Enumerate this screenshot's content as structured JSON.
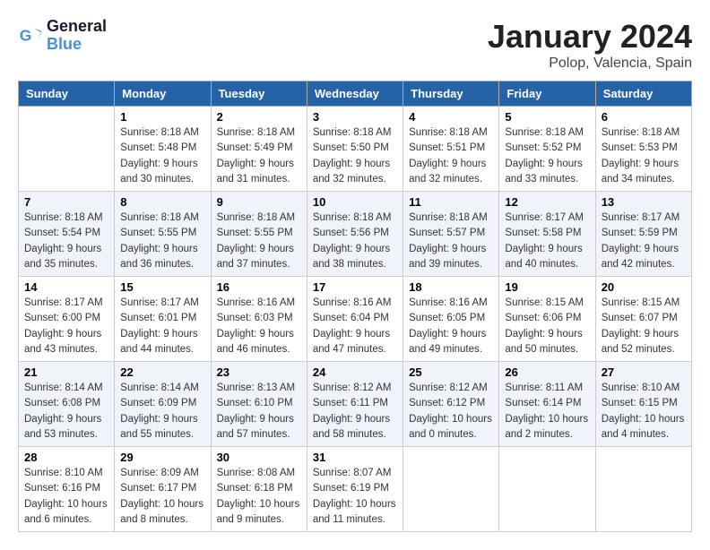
{
  "header": {
    "logo_line1": "General",
    "logo_line2": "Blue",
    "month_title": "January 2024",
    "location": "Polop, Valencia, Spain"
  },
  "days_of_week": [
    "Sunday",
    "Monday",
    "Tuesday",
    "Wednesday",
    "Thursday",
    "Friday",
    "Saturday"
  ],
  "weeks": [
    [
      {
        "num": "",
        "sunrise": "",
        "sunset": "",
        "daylight": "",
        "empty": true
      },
      {
        "num": "1",
        "sunrise": "Sunrise: 8:18 AM",
        "sunset": "Sunset: 5:48 PM",
        "daylight": "Daylight: 9 hours and 30 minutes."
      },
      {
        "num": "2",
        "sunrise": "Sunrise: 8:18 AM",
        "sunset": "Sunset: 5:49 PM",
        "daylight": "Daylight: 9 hours and 31 minutes."
      },
      {
        "num": "3",
        "sunrise": "Sunrise: 8:18 AM",
        "sunset": "Sunset: 5:50 PM",
        "daylight": "Daylight: 9 hours and 32 minutes."
      },
      {
        "num": "4",
        "sunrise": "Sunrise: 8:18 AM",
        "sunset": "Sunset: 5:51 PM",
        "daylight": "Daylight: 9 hours and 32 minutes."
      },
      {
        "num": "5",
        "sunrise": "Sunrise: 8:18 AM",
        "sunset": "Sunset: 5:52 PM",
        "daylight": "Daylight: 9 hours and 33 minutes."
      },
      {
        "num": "6",
        "sunrise": "Sunrise: 8:18 AM",
        "sunset": "Sunset: 5:53 PM",
        "daylight": "Daylight: 9 hours and 34 minutes."
      }
    ],
    [
      {
        "num": "7",
        "sunrise": "Sunrise: 8:18 AM",
        "sunset": "Sunset: 5:54 PM",
        "daylight": "Daylight: 9 hours and 35 minutes."
      },
      {
        "num": "8",
        "sunrise": "Sunrise: 8:18 AM",
        "sunset": "Sunset: 5:55 PM",
        "daylight": "Daylight: 9 hours and 36 minutes."
      },
      {
        "num": "9",
        "sunrise": "Sunrise: 8:18 AM",
        "sunset": "Sunset: 5:55 PM",
        "daylight": "Daylight: 9 hours and 37 minutes."
      },
      {
        "num": "10",
        "sunrise": "Sunrise: 8:18 AM",
        "sunset": "Sunset: 5:56 PM",
        "daylight": "Daylight: 9 hours and 38 minutes."
      },
      {
        "num": "11",
        "sunrise": "Sunrise: 8:18 AM",
        "sunset": "Sunset: 5:57 PM",
        "daylight": "Daylight: 9 hours and 39 minutes."
      },
      {
        "num": "12",
        "sunrise": "Sunrise: 8:17 AM",
        "sunset": "Sunset: 5:58 PM",
        "daylight": "Daylight: 9 hours and 40 minutes."
      },
      {
        "num": "13",
        "sunrise": "Sunrise: 8:17 AM",
        "sunset": "Sunset: 5:59 PM",
        "daylight": "Daylight: 9 hours and 42 minutes."
      }
    ],
    [
      {
        "num": "14",
        "sunrise": "Sunrise: 8:17 AM",
        "sunset": "Sunset: 6:00 PM",
        "daylight": "Daylight: 9 hours and 43 minutes."
      },
      {
        "num": "15",
        "sunrise": "Sunrise: 8:17 AM",
        "sunset": "Sunset: 6:01 PM",
        "daylight": "Daylight: 9 hours and 44 minutes."
      },
      {
        "num": "16",
        "sunrise": "Sunrise: 8:16 AM",
        "sunset": "Sunset: 6:03 PM",
        "daylight": "Daylight: 9 hours and 46 minutes."
      },
      {
        "num": "17",
        "sunrise": "Sunrise: 8:16 AM",
        "sunset": "Sunset: 6:04 PM",
        "daylight": "Daylight: 9 hours and 47 minutes."
      },
      {
        "num": "18",
        "sunrise": "Sunrise: 8:16 AM",
        "sunset": "Sunset: 6:05 PM",
        "daylight": "Daylight: 9 hours and 49 minutes."
      },
      {
        "num": "19",
        "sunrise": "Sunrise: 8:15 AM",
        "sunset": "Sunset: 6:06 PM",
        "daylight": "Daylight: 9 hours and 50 minutes."
      },
      {
        "num": "20",
        "sunrise": "Sunrise: 8:15 AM",
        "sunset": "Sunset: 6:07 PM",
        "daylight": "Daylight: 9 hours and 52 minutes."
      }
    ],
    [
      {
        "num": "21",
        "sunrise": "Sunrise: 8:14 AM",
        "sunset": "Sunset: 6:08 PM",
        "daylight": "Daylight: 9 hours and 53 minutes."
      },
      {
        "num": "22",
        "sunrise": "Sunrise: 8:14 AM",
        "sunset": "Sunset: 6:09 PM",
        "daylight": "Daylight: 9 hours and 55 minutes."
      },
      {
        "num": "23",
        "sunrise": "Sunrise: 8:13 AM",
        "sunset": "Sunset: 6:10 PM",
        "daylight": "Daylight: 9 hours and 57 minutes."
      },
      {
        "num": "24",
        "sunrise": "Sunrise: 8:12 AM",
        "sunset": "Sunset: 6:11 PM",
        "daylight": "Daylight: 9 hours and 58 minutes."
      },
      {
        "num": "25",
        "sunrise": "Sunrise: 8:12 AM",
        "sunset": "Sunset: 6:12 PM",
        "daylight": "Daylight: 10 hours and 0 minutes."
      },
      {
        "num": "26",
        "sunrise": "Sunrise: 8:11 AM",
        "sunset": "Sunset: 6:14 PM",
        "daylight": "Daylight: 10 hours and 2 minutes."
      },
      {
        "num": "27",
        "sunrise": "Sunrise: 8:10 AM",
        "sunset": "Sunset: 6:15 PM",
        "daylight": "Daylight: 10 hours and 4 minutes."
      }
    ],
    [
      {
        "num": "28",
        "sunrise": "Sunrise: 8:10 AM",
        "sunset": "Sunset: 6:16 PM",
        "daylight": "Daylight: 10 hours and 6 minutes."
      },
      {
        "num": "29",
        "sunrise": "Sunrise: 8:09 AM",
        "sunset": "Sunset: 6:17 PM",
        "daylight": "Daylight: 10 hours and 8 minutes."
      },
      {
        "num": "30",
        "sunrise": "Sunrise: 8:08 AM",
        "sunset": "Sunset: 6:18 PM",
        "daylight": "Daylight: 10 hours and 9 minutes."
      },
      {
        "num": "31",
        "sunrise": "Sunrise: 8:07 AM",
        "sunset": "Sunset: 6:19 PM",
        "daylight": "Daylight: 10 hours and 11 minutes."
      },
      {
        "num": "",
        "sunrise": "",
        "sunset": "",
        "daylight": "",
        "empty": true
      },
      {
        "num": "",
        "sunrise": "",
        "sunset": "",
        "daylight": "",
        "empty": true
      },
      {
        "num": "",
        "sunrise": "",
        "sunset": "",
        "daylight": "",
        "empty": true
      }
    ]
  ]
}
